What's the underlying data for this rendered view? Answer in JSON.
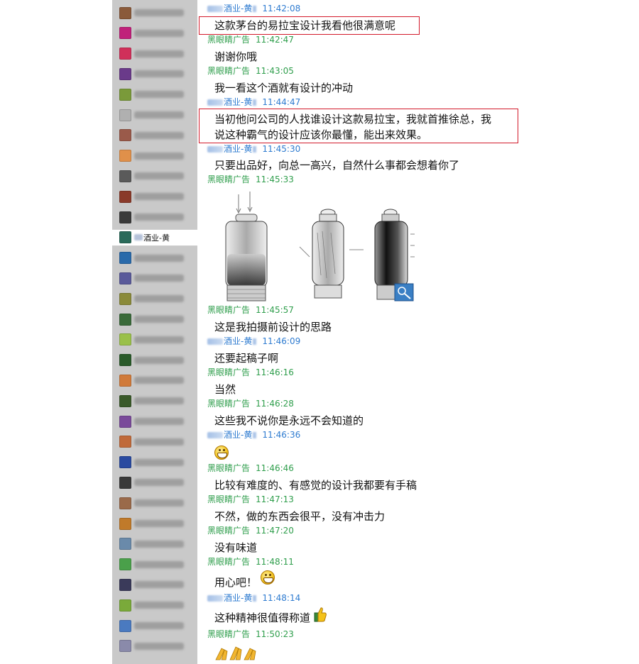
{
  "sidebar": {
    "contacts": [
      {
        "avatar_color": "#8a5a3a"
      },
      {
        "avatar_color": "#c0207a"
      },
      {
        "avatar_color": "#d0305a"
      },
      {
        "avatar_color": "#6a3a8a"
      },
      {
        "avatar_color": "#7a9a3a"
      },
      {
        "avatar_color": "#b0b0b0"
      },
      {
        "avatar_color": "#9a5a4a"
      },
      {
        "avatar_color": "#e0904a"
      },
      {
        "avatar_color": "#5a5a5a"
      },
      {
        "avatar_color": "#8a3a2a"
      },
      {
        "avatar_color": "#3a3a3a"
      }
    ],
    "active_contact": {
      "label": "酒业-黄",
      "avatar_color": "#2a6a5a"
    },
    "contacts_after": [
      {
        "avatar_color": "#2a6aaa"
      },
      {
        "avatar_color": "#5a5a9a"
      },
      {
        "avatar_color": "#8a8a3a"
      },
      {
        "avatar_color": "#3a6a3a"
      },
      {
        "avatar_color": "#9ac04a"
      },
      {
        "avatar_color": "#2a5a2a"
      },
      {
        "avatar_color": "#d07a3a"
      },
      {
        "avatar_color": "#3a5a2a"
      },
      {
        "avatar_color": "#7a4a9a"
      },
      {
        "avatar_color": "#c06a3a"
      },
      {
        "avatar_color": "#2a4aa0"
      },
      {
        "avatar_color": "#3a3a3a"
      },
      {
        "avatar_color": "#9a6a4a"
      },
      {
        "avatar_color": "#c07a2a"
      },
      {
        "avatar_color": "#6a8aaa"
      },
      {
        "avatar_color": "#4aa04a"
      },
      {
        "avatar_color": "#3a3a5a"
      },
      {
        "avatar_color": "#7aaa3a"
      },
      {
        "avatar_color": "#4a7ac0"
      },
      {
        "avatar_color": "#8a8aaa"
      }
    ]
  },
  "chat": {
    "messages": [
      {
        "sender": "酒业-黄",
        "time": "11:42:08",
        "text": "这款茅台的易拉宝设计我看他很满意呢",
        "highlighted": true
      },
      {
        "sender": "黑眼睛广告",
        "time": "11:42:47",
        "text": "谢谢你哦"
      },
      {
        "sender": "黑眼睛广告",
        "time": "11:43:05",
        "text": "我一看这个酒就有设计的冲动"
      },
      {
        "sender": "酒业-黄",
        "time": "11:44:47",
        "text_line1": "当初他问公司的人找谁设计这款易拉宝，我就首推徐总，我",
        "text_line2": "说这种霸气的设计应该你最懂，能出来效果。",
        "highlighted": true
      },
      {
        "sender": "酒业-黄",
        "time": "11:45:30",
        "text": "只要出品好，向总一高兴，自然什么事都会想着你了"
      },
      {
        "sender": "黑眼睛广告",
        "time": "11:45:33",
        "image": "bottle-sketch"
      },
      {
        "sender": "黑眼睛广告",
        "time": "11:45:57",
        "text": "这是我拍摄前设计的思路"
      },
      {
        "sender": "酒业-黄",
        "time": "11:46:09",
        "text": "还要起稿子啊"
      },
      {
        "sender": "黑眼睛广告",
        "time": "11:46:16",
        "text": "当然"
      },
      {
        "sender": "黑眼睛广告",
        "time": "11:46:28",
        "text": "这些我不说你是永远不会知道的"
      },
      {
        "sender": "酒业-黄",
        "time": "11:46:36",
        "emoji": "grin"
      },
      {
        "sender": "黑眼睛广告",
        "time": "11:46:46",
        "text": "比较有难度的、有感觉的设计我都要有手稿"
      },
      {
        "sender": "黑眼睛广告",
        "time": "11:47:13",
        "text": "不然，做的东西会很平，没有冲击力"
      },
      {
        "sender": "黑眼睛广告",
        "time": "11:47:20",
        "text": "没有味道"
      },
      {
        "sender": "黑眼睛广告",
        "time": "11:48:11",
        "text": "用心吧！",
        "emoji": "grin"
      },
      {
        "sender": "酒业-黄",
        "time": "11:48:14",
        "text": "这种精神很值得称道",
        "emoji": "thumbs-up"
      },
      {
        "sender": "黑眼睛广告",
        "time": "11:50:23",
        "emoji": "clapping-hands"
      }
    ]
  },
  "colors": {
    "them_name": "#2e7bd0",
    "me_name": "#2f9e4c",
    "highlight_box": "#d21a2a",
    "sidebar_bg": "#c9c9c9"
  }
}
